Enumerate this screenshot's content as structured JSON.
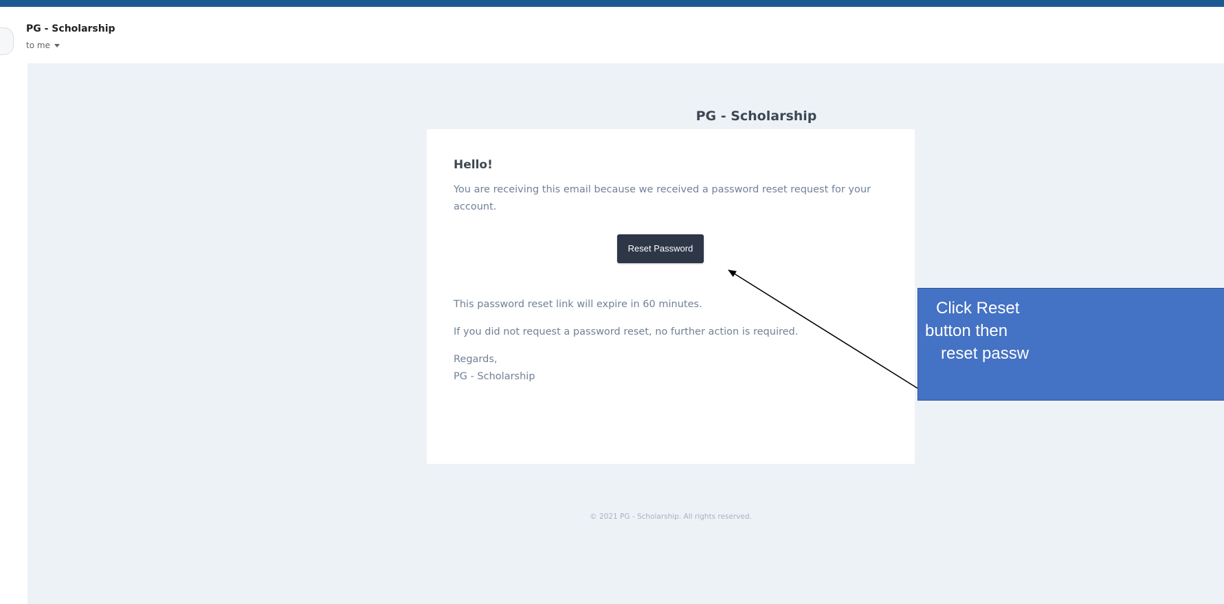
{
  "email": {
    "sender_name": "PG - Scholarship",
    "recipient": "to me"
  },
  "mail": {
    "header_title": "PG - Scholarship",
    "greeting": "Hello!",
    "intro": "You are receiving this email because we received a password reset request for your account.",
    "button_label": "Reset Password",
    "expiry_note": "This password reset link will expire in 60 minutes.",
    "no_action_note": "If you did not request a password reset, no further action is required.",
    "regards": "Regards,",
    "signature": "PG - Scholarship",
    "footer": "© 2021 PG - Scholarship. All rights reserved."
  },
  "callout": {
    "line1": "Click Reset",
    "line2": "button then",
    "line3": "reset passw"
  },
  "colors": {
    "button_bg": "#2d3748",
    "mail_bg": "#edf2f7",
    "callout_bg": "#4472c4",
    "slide_bg": "#154a80"
  }
}
